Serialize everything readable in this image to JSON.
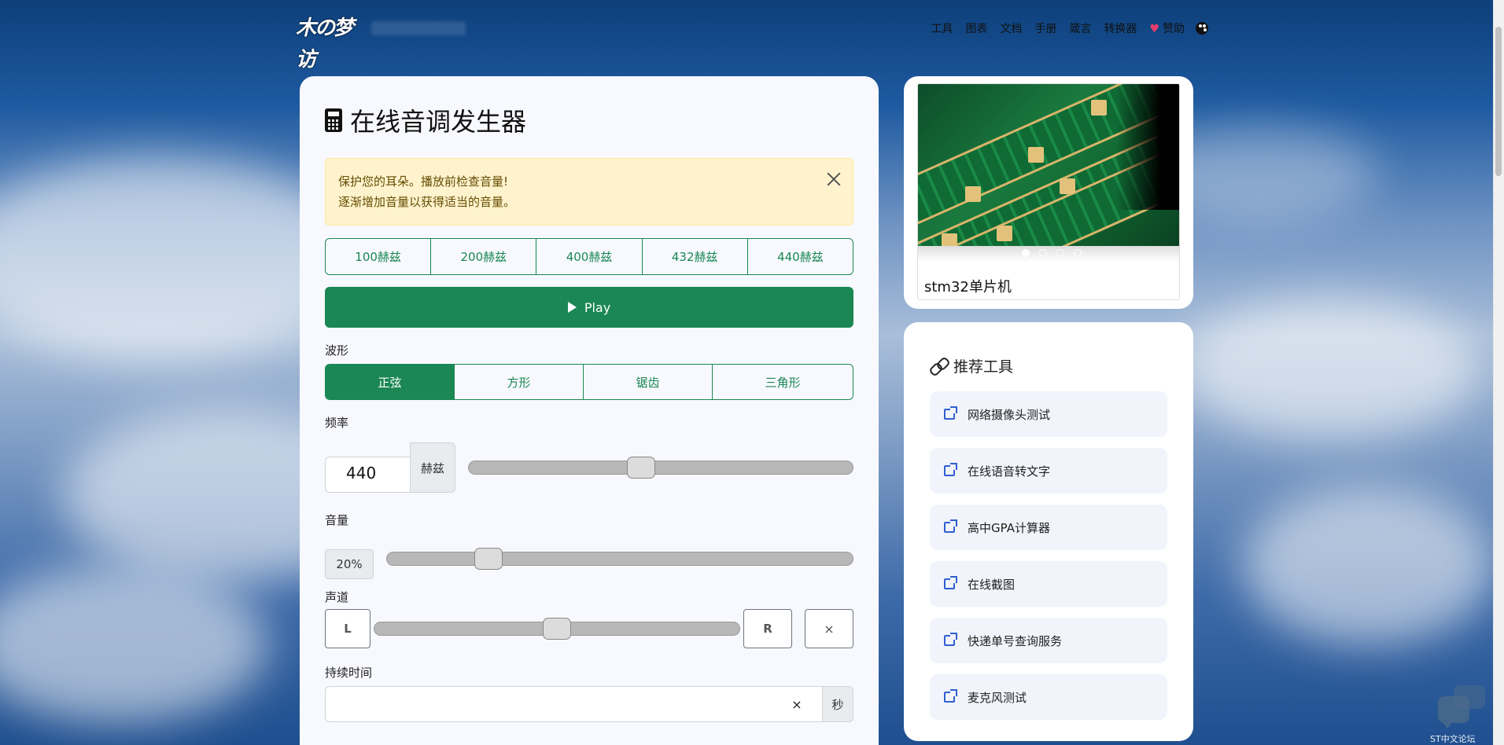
{
  "nav": {
    "logo_text": "木の梦访",
    "links": [
      "工具",
      "图表",
      "文档",
      "手册",
      "箴言",
      "转换器",
      "赞助"
    ]
  },
  "main": {
    "title": "在线音调发生器",
    "alert_line1": "保护您的耳朵。播放前检查音量!",
    "alert_line2": "逐渐增加音量以获得适当的音量。",
    "presets": [
      "100赫兹",
      "200赫兹",
      "400赫兹",
      "432赫兹",
      "440赫兹"
    ],
    "play_label": "Play",
    "waveform_label": "波形",
    "waveforms": [
      "正弦",
      "方形",
      "锯齿",
      "三角形"
    ],
    "waveform_selected": "正弦",
    "frequency_label": "频率",
    "frequency_value": "440",
    "frequency_unit": "赫兹",
    "frequency_slider_fraction": 0.445,
    "volume_label": "音量",
    "volume_value": "20%",
    "volume_slider_fraction": 0.2,
    "channel_label": "声道",
    "channel_left": "L",
    "channel_right": "R",
    "channel_slider_fraction": 0.5,
    "channel_reset": "×",
    "duration_label": "持续时间",
    "duration_value": "",
    "duration_clear": "×",
    "duration_unit": "秒"
  },
  "ad": {
    "title": "stm32单片机",
    "slides": 4,
    "active_slide": 0
  },
  "tools": {
    "heading": "推荐工具",
    "items": [
      "网络摄像头测试",
      "在线语音转文字",
      "高中GPA计算器",
      "在线截图",
      "快递单号查询服务",
      "麦克风测试"
    ]
  },
  "widget": {
    "text": "ST中文论坛"
  },
  "colors": {
    "accent_green": "#1b8754",
    "alert_bg": "#fff3cd",
    "tool_link_blue": "#2f5fd0"
  }
}
